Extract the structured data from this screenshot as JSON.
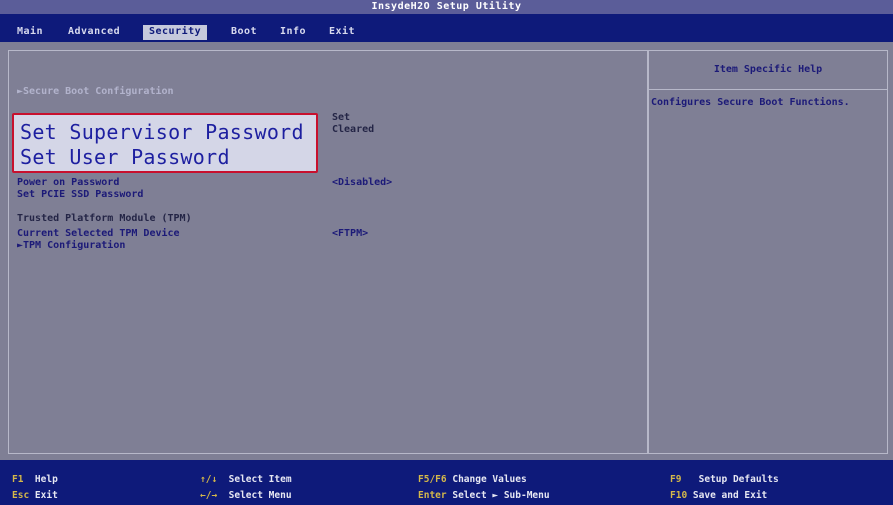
{
  "title": "InsydeH2O Setup Utility",
  "menu": {
    "main": "Main",
    "advanced": "Advanced",
    "security": "Security",
    "boot": "Boot",
    "info": "Info",
    "exit": "Exit"
  },
  "security": {
    "secure_boot": "►Secure Boot Configuration",
    "supervisor_status": "Set",
    "user_status": "Cleared",
    "set_supervisor_password": "Set Supervisor Password",
    "set_user_password": "Set User Password",
    "power_on_password": "Power on Password",
    "power_on_password_value": "<Disabled>",
    "set_pcie_ssd_password": "Set PCIE SSD Password",
    "tpm_heading": "Trusted Platform Module (TPM)",
    "current_tpm_device": "Current Selected TPM Device",
    "current_tpm_device_value": "<FTPM>",
    "tpm_configuration": "►TPM Configuration"
  },
  "help": {
    "title": "Item Specific Help",
    "text": "Configures Secure Boot Functions."
  },
  "footer": [
    {
      "key": "F1",
      "desc": "Help"
    },
    {
      "key": "Esc",
      "desc": "Exit"
    },
    {
      "key": "↑/↓",
      "desc": "Select Item"
    },
    {
      "key": "←/→",
      "desc": "Select Menu"
    },
    {
      "key": "F5/F6",
      "desc": "Change Values"
    },
    {
      "key": "Enter",
      "desc": "Select ► Sub-Menu"
    },
    {
      "key": "F9",
      "desc": "Setup Defaults"
    },
    {
      "key": "F10",
      "desc": "Save and Exit"
    }
  ],
  "colors": {
    "background": "#7f7f95",
    "menubar": "#0e1a7a",
    "highlight_border": "#c8102e",
    "item_text": "#1c1a78"
  }
}
